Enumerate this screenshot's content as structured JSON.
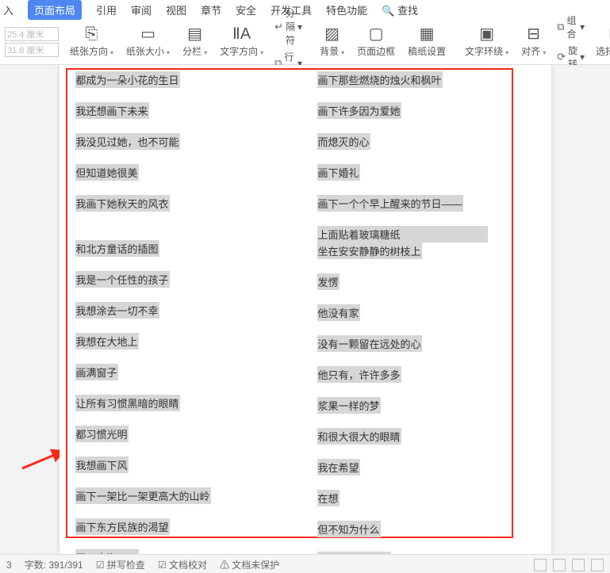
{
  "tabs": {
    "insert": "入",
    "layout": "页面布局",
    "ref": "引用",
    "review": "审阅",
    "view": "视图",
    "section": "章节",
    "security": "安全",
    "dev": "开发工具",
    "special": "特色功能",
    "search": "查找"
  },
  "size": {
    "w": "25.4 厘米",
    "h": "31.8 厘米"
  },
  "ribbon": {
    "orient": "纸张方向",
    "papersize": "纸张大小",
    "columns": "分栏",
    "textdir": "文字方向",
    "sep": "分隔符",
    "lineno": "行号",
    "bg": "背景",
    "border": "页面边框",
    "manu": "稿纸设置",
    "wrap": "文字环绕",
    "align": "对齐",
    "group": "组合",
    "rotate": "旋转",
    "selpane": "选择窗格"
  },
  "left": [
    "都成为一朵小花的生日",
    "我还想画下未来",
    "我没见过她，也不可能",
    "但知道她很美",
    "我画下她秋天的风衣",
    "",
    "和北方童话的插图",
    "我是一个任性的孩子",
    "我想涂去一切不幸",
    "我想在大地上",
    "画满窗子",
    "让所有习惯黑暗的眼睛",
    "都习惯光明",
    "我想画下风",
    "画下一架比一架更高大的山岭",
    "画下东方民族的渴望",
    "画下大海——"
  ],
  "right_top": [
    "画下那些燃烧的烛火和枫叶",
    "画下许多因为爱她",
    "而熄灭的心",
    "画下婚礼",
    "画下一个个早上醒来的节日——"
  ],
  "right_pair_a": "上面贴着玻璃糖纸",
  "right_pair_b": "坐在安安静静的树枝上",
  "right_rest": [
    "发愣",
    "他没有家",
    "没有一颗留在远处的心",
    "他只有，许许多多",
    "浆果一样的梦",
    "和很大很大的眼睛",
    "我在希望",
    "在想",
    "但不知为什么",
    "我没有领到蜡笔"
  ],
  "status": {
    "page": "3",
    "words": "字数: 391/391",
    "spell": "拼写检查",
    "proof": "文档校对",
    "protect": "文档未保护"
  }
}
